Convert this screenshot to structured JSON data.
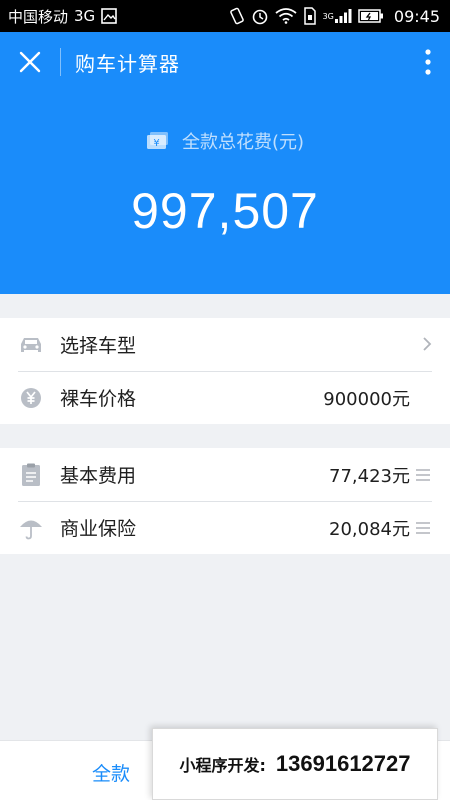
{
  "status_bar": {
    "carrier": "中国移动",
    "network": "3G",
    "signal_network": "3G",
    "time": "09:45"
  },
  "nav": {
    "title": "购车计算器"
  },
  "summary": {
    "label": "全款总花费(元)",
    "total": "997,507",
    "icon_text": "¥"
  },
  "group1": [
    {
      "label": "选择车型",
      "value": "",
      "icon": "car-icon",
      "trailing": "chevron"
    },
    {
      "label": "裸车价格",
      "value": "900000元",
      "icon": "yen-icon",
      "trailing": "none"
    }
  ],
  "group2": [
    {
      "label": "基本费用",
      "value": "77,423元",
      "icon": "document-icon",
      "trailing": "menu"
    },
    {
      "label": "商业保险",
      "value": "20,084元",
      "icon": "umbrella-icon",
      "trailing": "menu"
    }
  ],
  "bottom": {
    "tab_full": "全款"
  },
  "promo": {
    "label": "小程序开发:",
    "phone": "13691612727"
  },
  "colors": {
    "primary": "#1a8cfa",
    "background": "#eff1f4",
    "icon_gray": "#b9bec6"
  }
}
